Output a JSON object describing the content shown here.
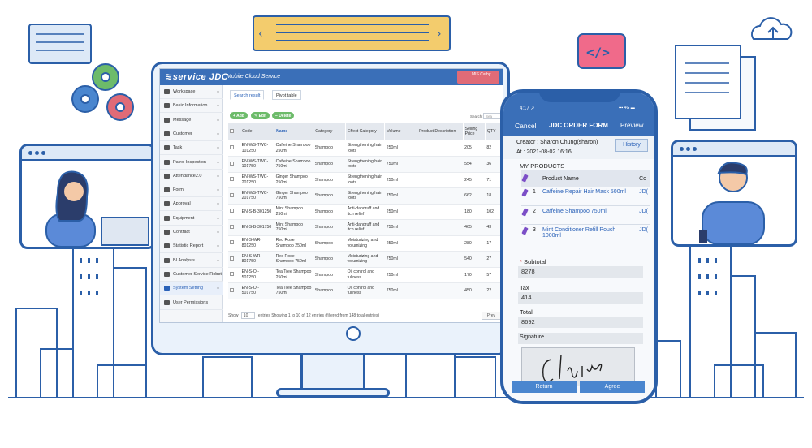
{
  "app": {
    "logo": "≋service JDC",
    "subtitle": "Mobile Cloud Service",
    "user": "MIS Cathy"
  },
  "sidebar": {
    "items": [
      {
        "label": "Workspace",
        "icon": "monitor-icon"
      },
      {
        "label": "Basic Information",
        "icon": "table-icon"
      },
      {
        "label": "Message",
        "icon": "chat-icon"
      },
      {
        "label": "Customer",
        "icon": "users-icon"
      },
      {
        "label": "Task",
        "icon": "checklist-icon"
      },
      {
        "label": "Patrol Inspection",
        "icon": "patrol-icon"
      },
      {
        "label": "Attendance2.0",
        "icon": "location-icon"
      },
      {
        "label": "Form",
        "icon": "form-icon"
      },
      {
        "label": "Approval",
        "icon": "approval-icon"
      },
      {
        "label": "Equipment",
        "icon": "equipment-icon"
      },
      {
        "label": "Contract",
        "icon": "contract-icon"
      },
      {
        "label": "Statistic Report",
        "icon": "report-icon"
      },
      {
        "label": "BI Analysis",
        "icon": "chart-icon"
      },
      {
        "label": "Customer Service Robot",
        "icon": "robot-icon"
      },
      {
        "label": "System Setting",
        "icon": "gear-icon"
      },
      {
        "label": "User Permissions",
        "icon": "permission-icon"
      }
    ]
  },
  "tabs": {
    "search_result": "Search result",
    "pivot_table": "Pivot table"
  },
  "toolbar": {
    "add": "+ Add",
    "edit": "✎ Edit",
    "delete": "− Delete",
    "search_label": "Search:",
    "search_placeholder": "Sea"
  },
  "table": {
    "headers": [
      "Code",
      "Name",
      "Category",
      "Effect Category",
      "Volume",
      "Product Description",
      "Selling Price",
      "QTY"
    ],
    "rows": [
      [
        "EN-WS-TWC-101250",
        "Caffeine Shampoo 250ml",
        "Shampoo",
        "Strengthening hair roots",
        "250ml",
        "",
        "205",
        "82"
      ],
      [
        "EN-WS-TWC-101750",
        "Caffeine Shampoo 750ml",
        "Shampoo",
        "Strengthening hair roots",
        "750ml",
        "",
        "554",
        "36"
      ],
      [
        "EN-WS-TWC-201250",
        "Ginger Shampoo 250ml",
        "Shampoo",
        "Strengthening hair roots",
        "250ml",
        "",
        "245",
        "71"
      ],
      [
        "EN-WS-TWC-201750",
        "Ginger Shampoo 750ml",
        "Shampoo",
        "Strengthening hair roots",
        "750ml",
        "",
        "662",
        "18"
      ],
      [
        "EN-S-B-301250",
        "Mint Shampoo 250ml",
        "Shampoo",
        "Anti-dandruff and itch relief",
        "250ml",
        "",
        "180",
        "102"
      ],
      [
        "EN-S-B-301750",
        "Mint Shampoo 750ml",
        "Shampoo",
        "Anti-dandruff and itch relief",
        "750ml",
        "",
        "465",
        "43"
      ],
      [
        "EN-S-WR-801250",
        "Red Rose Shampoo 250ml",
        "Shampoo",
        "Moisturizing and volumizing",
        "250ml",
        "",
        "280",
        "17"
      ],
      [
        "EN-S-WR-801750",
        "Red Rose Shampoo 750ml",
        "Shampoo",
        "Moisturizing and volumizing",
        "750ml",
        "",
        "540",
        "27"
      ],
      [
        "EN-S-OI-501250",
        "Tea Tree Shampoo 250ml",
        "Shampoo",
        "Oil control and fullness",
        "250ml",
        "",
        "170",
        "57"
      ],
      [
        "EN-S-OI-501750",
        "Tea Tree Shampoo 750ml",
        "Shampoo",
        "Oil control and fullness",
        "750ml",
        "",
        "450",
        "22"
      ]
    ]
  },
  "footer": {
    "show": "Show",
    "show_value": "10",
    "entries": "entries",
    "summary": "Showing 1 to 10 of 12 entries (filtered from 148 total entries)",
    "prev": "Prev"
  },
  "phone": {
    "time": "4:17 ↗",
    "status": "▪▪▪ 4G ▬",
    "cancel": "Cancel",
    "title": "JDC ORDER FORM",
    "preview": "Preview",
    "creator": "Creator : Sharon Chung(sharon)",
    "at": "At : 2021-08-02 16:16",
    "history": "History",
    "my_products": "MY PRODUCTS",
    "product_header": "Product Name",
    "col_header": "Co",
    "products": [
      {
        "num": "1",
        "name": "Caffeine Repair Hair Mask 500ml",
        "code": "JD("
      },
      {
        "num": "2",
        "name": "Caffeine Shampoo 750ml",
        "code": "JD("
      },
      {
        "num": "3",
        "name": "Mint Conditioner Refill Pouch 1000ml",
        "code": "JD("
      }
    ],
    "subtotal_label": "Subtotal",
    "subtotal": "8278",
    "tax_label": "Tax",
    "tax": "414",
    "total_label": "Total",
    "total": "8692",
    "signature_label": "Signature",
    "signature_text": "Claire",
    "return": "Return",
    "agree": "Agree"
  },
  "colors": {
    "brand": "#3a6fb8",
    "outline": "#2b5fa8",
    "accent_green": "#6dbb6a",
    "accent_pink": "#e06b77"
  }
}
